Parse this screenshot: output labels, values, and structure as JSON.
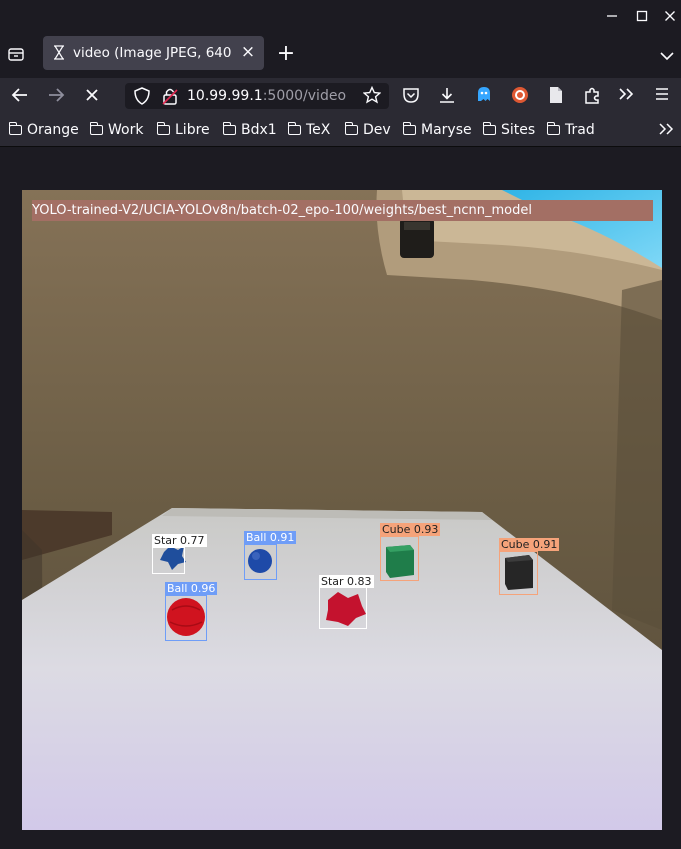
{
  "window": {
    "minimize_icon": "minimize-icon",
    "maximize_icon": "maximize-icon",
    "close_icon": "close-icon"
  },
  "tab": {
    "title": "video (Image JPEG, 640 ×",
    "close_label": "×",
    "new_tab_label": "+"
  },
  "url": {
    "host": "10.99.99.1",
    "rest": ":5000/video"
  },
  "bookmarks": [
    "Orange",
    "Work",
    "Libre",
    "Bdx1",
    "TeX",
    "Dev",
    "Maryse",
    "Sites",
    "Trad"
  ],
  "image": {
    "model_label": "YOLO-trained-V2/UCIA-YOLOv8n/batch-02_epo-100/weights/best_ncnn_model",
    "detections": [
      {
        "label": "Star 0.77",
        "color": "#ffffff",
        "kind": "star"
      },
      {
        "label": "Ball 0.91",
        "color": "#6f9df7",
        "kind": "ball-blue"
      },
      {
        "label": "Cube 0.93",
        "color": "#f5a37a",
        "kind": "cube-green"
      },
      {
        "label": "Cube 0.91",
        "color": "#f5a37a",
        "kind": "cube-black"
      },
      {
        "label": "Star 0.83",
        "color": "#ffffff",
        "kind": "star-red"
      },
      {
        "label": "Ball 0.96",
        "color": "#6f9df7",
        "kind": "ball-red"
      }
    ]
  }
}
